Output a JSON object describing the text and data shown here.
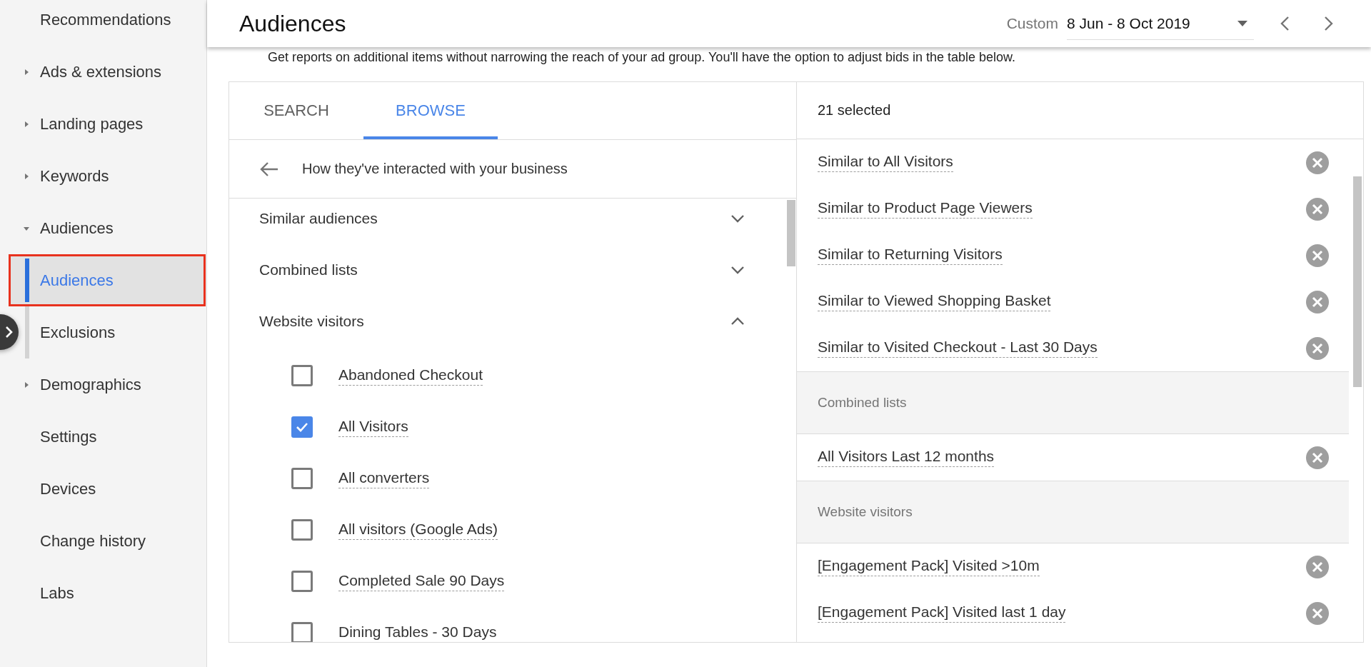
{
  "sidebar": {
    "items": [
      {
        "label": "Recommendations",
        "kind": "link",
        "selected": false
      },
      {
        "label": "Ads & extensions",
        "kind": "group",
        "expanded": false,
        "selected": false
      },
      {
        "label": "Landing pages",
        "kind": "group",
        "expanded": false,
        "selected": false
      },
      {
        "label": "Keywords",
        "kind": "group",
        "expanded": false,
        "selected": false
      },
      {
        "label": "Audiences",
        "kind": "group",
        "expanded": true,
        "selected": false,
        "children": [
          {
            "label": "Audiences",
            "selected": true,
            "highlighted": true
          },
          {
            "label": "Exclusions",
            "selected": false,
            "highlighted": false
          }
        ]
      },
      {
        "label": "Demographics",
        "kind": "group",
        "expanded": false,
        "selected": false
      },
      {
        "label": "Settings",
        "kind": "link",
        "selected": false
      },
      {
        "label": "Devices",
        "kind": "link",
        "selected": false
      },
      {
        "label": "Change history",
        "kind": "link",
        "selected": false
      },
      {
        "label": "Labs",
        "kind": "link",
        "selected": false
      }
    ]
  },
  "header": {
    "title": "Audiences",
    "date_range": {
      "label": "Custom",
      "value": "8 Jun - 8 Oct 2019"
    }
  },
  "description": "Get reports on additional items without narrowing the reach of your ad group. You'll have the option to adjust bids in the table below.",
  "tabs": [
    {
      "label": "SEARCH",
      "selected": false
    },
    {
      "label": "BROWSE",
      "selected": true
    }
  ],
  "browse": {
    "back_label": "How they've interacted with your business",
    "categories": [
      {
        "label": "Similar audiences",
        "expanded": false
      },
      {
        "label": "Combined lists",
        "expanded": false
      },
      {
        "label": "Website visitors",
        "expanded": true,
        "options": [
          {
            "label": "Abandoned Checkout",
            "checked": false
          },
          {
            "label": "All Visitors",
            "checked": true
          },
          {
            "label": "All converters",
            "checked": false
          },
          {
            "label": "All visitors (Google Ads)",
            "checked": false
          },
          {
            "label": "Completed Sale 90 Days",
            "checked": false
          },
          {
            "label": "Dining Tables - 30 Days",
            "checked": false
          }
        ]
      }
    ]
  },
  "selected_panel": {
    "count_label": "21 selected",
    "groups": [
      {
        "items": [
          "Similar to All Visitors",
          "Similar to Product Page Viewers",
          "Similar to Returning Visitors",
          "Similar to Viewed Shopping Basket",
          "Similar to Visited Checkout - Last 30 Days"
        ]
      },
      {
        "heading": "Combined lists",
        "items": [
          "All Visitors Last 12 months"
        ]
      },
      {
        "heading": "Website visitors",
        "items": [
          "[Engagement Pack] Visited >10m",
          "[Engagement Pack] Visited last 1 day"
        ]
      }
    ]
  }
}
